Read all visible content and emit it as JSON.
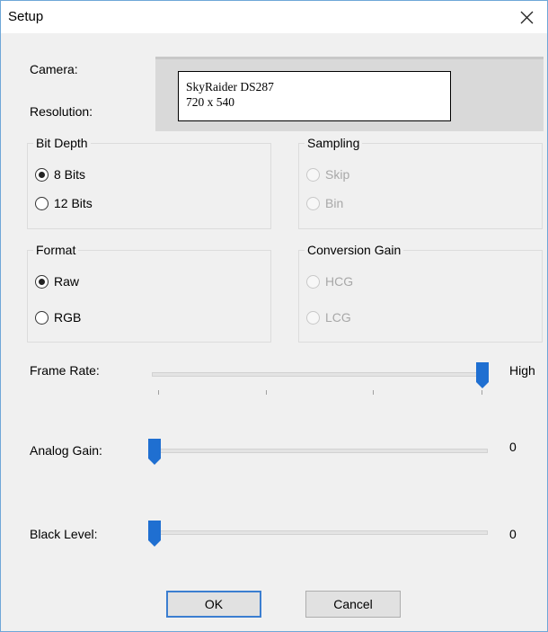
{
  "window": {
    "title": "Setup"
  },
  "camera": {
    "label": "Camera:",
    "value": "SkyRaider DS287"
  },
  "resolution": {
    "label": "Resolution:",
    "value": "720 x 540"
  },
  "bit_depth": {
    "title": "Bit Depth",
    "options": [
      {
        "label": "8 Bits",
        "checked": true
      },
      {
        "label": "12 Bits",
        "checked": false
      }
    ]
  },
  "sampling": {
    "title": "Sampling",
    "enabled": false,
    "options": [
      {
        "label": "Skip",
        "checked": false
      },
      {
        "label": "Bin",
        "checked": false
      }
    ]
  },
  "format": {
    "title": "Format",
    "options": [
      {
        "label": "Raw",
        "checked": true
      },
      {
        "label": "RGB",
        "checked": false
      }
    ]
  },
  "conversion_gain": {
    "title": "Conversion Gain",
    "enabled": false,
    "options": [
      {
        "label": "HCG",
        "checked": false
      },
      {
        "label": "LCG",
        "checked": false
      }
    ]
  },
  "frame_rate": {
    "label": "Frame Rate:",
    "value_label": "High",
    "level": 1.0
  },
  "analog_gain": {
    "label": "Analog Gain:",
    "value": "0",
    "level": 0.0
  },
  "black_level": {
    "label": "Black Level:",
    "value": "0",
    "level": 0.0
  },
  "buttons": {
    "ok": "OK",
    "cancel": "Cancel"
  },
  "colors": {
    "accent": "#1f6fd1",
    "window_border": "#6fa7d8",
    "disabled_text": "#a8a8a8"
  },
  "icons": {
    "close": "close-icon",
    "slider_thumb": "slider-thumb-icon"
  }
}
